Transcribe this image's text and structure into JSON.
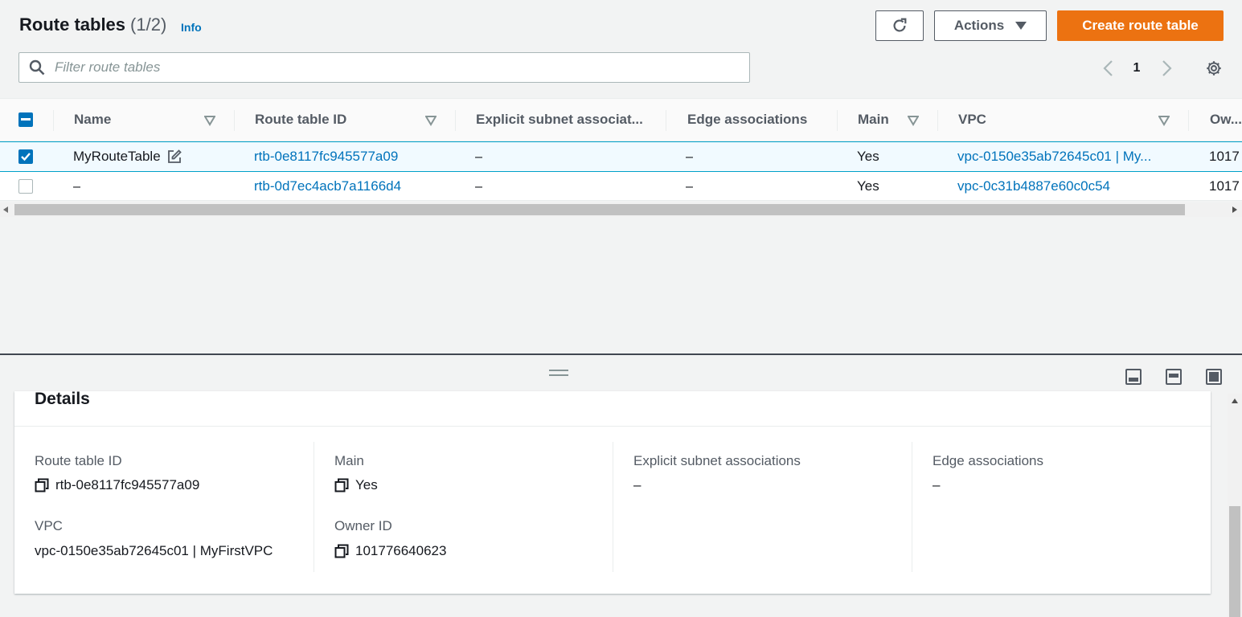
{
  "header": {
    "title": "Route tables",
    "count": "(1/2)",
    "info": "Info",
    "actions_label": "Actions",
    "create_label": "Create route table"
  },
  "filter": {
    "placeholder": "Filter route tables"
  },
  "pagination": {
    "page": "1"
  },
  "table": {
    "columns": {
      "name": "Name",
      "route_table_id": "Route table ID",
      "explicit": "Explicit subnet associat...",
      "edge": "Edge associations",
      "main": "Main",
      "vpc": "VPC",
      "owner": "Ow..."
    },
    "rows": [
      {
        "name": "MyRouteTable",
        "route_table_id": "rtb-0e8117fc945577a09",
        "explicit": "–",
        "edge": "–",
        "main": "Yes",
        "vpc": "vpc-0150e35ab72645c01 | My...",
        "owner": "1017",
        "selected": true
      },
      {
        "name": "–",
        "route_table_id": "rtb-0d7ec4acb7a1166d4",
        "explicit": "–",
        "edge": "–",
        "main": "Yes",
        "vpc": "vpc-0c31b4887e60c0c54",
        "owner": "1017",
        "selected": false
      }
    ]
  },
  "details": {
    "title": "Details",
    "route_table_id_label": "Route table ID",
    "route_table_id_value": "rtb-0e8117fc945577a09",
    "vpc_label": "VPC",
    "vpc_value": "vpc-0150e35ab72645c01 | MyFirstVPC",
    "main_label": "Main",
    "main_value": "Yes",
    "owner_label": "Owner ID",
    "owner_value": "101776640623",
    "explicit_label": "Explicit subnet associations",
    "explicit_value": "–",
    "edge_label": "Edge associations",
    "edge_value": "–"
  },
  "colors": {
    "primary": "#ec7211",
    "link": "#0073bb",
    "selected_row": "#f1faff",
    "selected_border": "#00a1c9"
  }
}
